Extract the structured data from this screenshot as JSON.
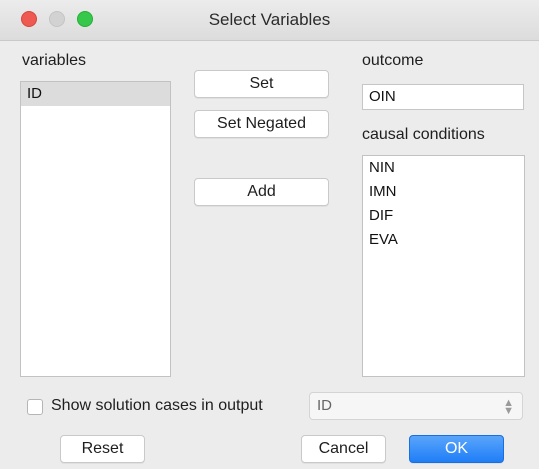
{
  "window": {
    "title": "Select Variables"
  },
  "variables": {
    "label": "variables",
    "items": [
      "ID"
    ],
    "selected": "ID"
  },
  "buttons": {
    "set": "Set",
    "set_negated": "Set Negated",
    "add": "Add",
    "reset": "Reset",
    "cancel": "Cancel",
    "ok": "OK"
  },
  "outcome": {
    "label": "outcome",
    "value": "OIN"
  },
  "causal_conditions": {
    "label": "causal conditions",
    "items": [
      "NIN",
      "IMN",
      "DIF",
      "EVA"
    ]
  },
  "options": {
    "show_solution_cases_label": "Show solution cases in output",
    "show_solution_cases_checked": false,
    "case_id_select_value": "ID"
  },
  "colors": {
    "accent": "#1f7ef7",
    "close": "#ee5a52",
    "maximize": "#36c84a"
  },
  "icons": {
    "select_chevron": "up-down-chevron-icon"
  }
}
